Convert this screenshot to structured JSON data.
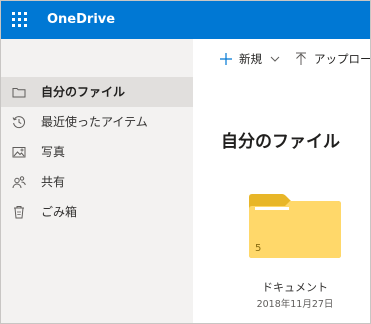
{
  "app": {
    "brand": "OneDrive"
  },
  "colors": {
    "header_bg": "#0078d4",
    "sidebar_bg": "#f3f2f1",
    "selected_bg": "#e1dfdd",
    "folder": "#fcd866"
  },
  "command_bar": {
    "new_label": "新規",
    "upload_label": "アップロード"
  },
  "sidebar": {
    "items": [
      {
        "label": "自分のファイル",
        "icon": "folder-icon",
        "selected": true
      },
      {
        "label": "最近使ったアイテム",
        "icon": "recent-icon",
        "selected": false
      },
      {
        "label": "写真",
        "icon": "photo-icon",
        "selected": false
      },
      {
        "label": "共有",
        "icon": "shared-icon",
        "selected": false
      },
      {
        "label": "ごみ箱",
        "icon": "trash-icon",
        "selected": false
      }
    ]
  },
  "main": {
    "title": "自分のファイル",
    "items": [
      {
        "name": "ドキュメント",
        "date": "2018年11月27日",
        "count": "5",
        "type": "folder"
      }
    ]
  }
}
